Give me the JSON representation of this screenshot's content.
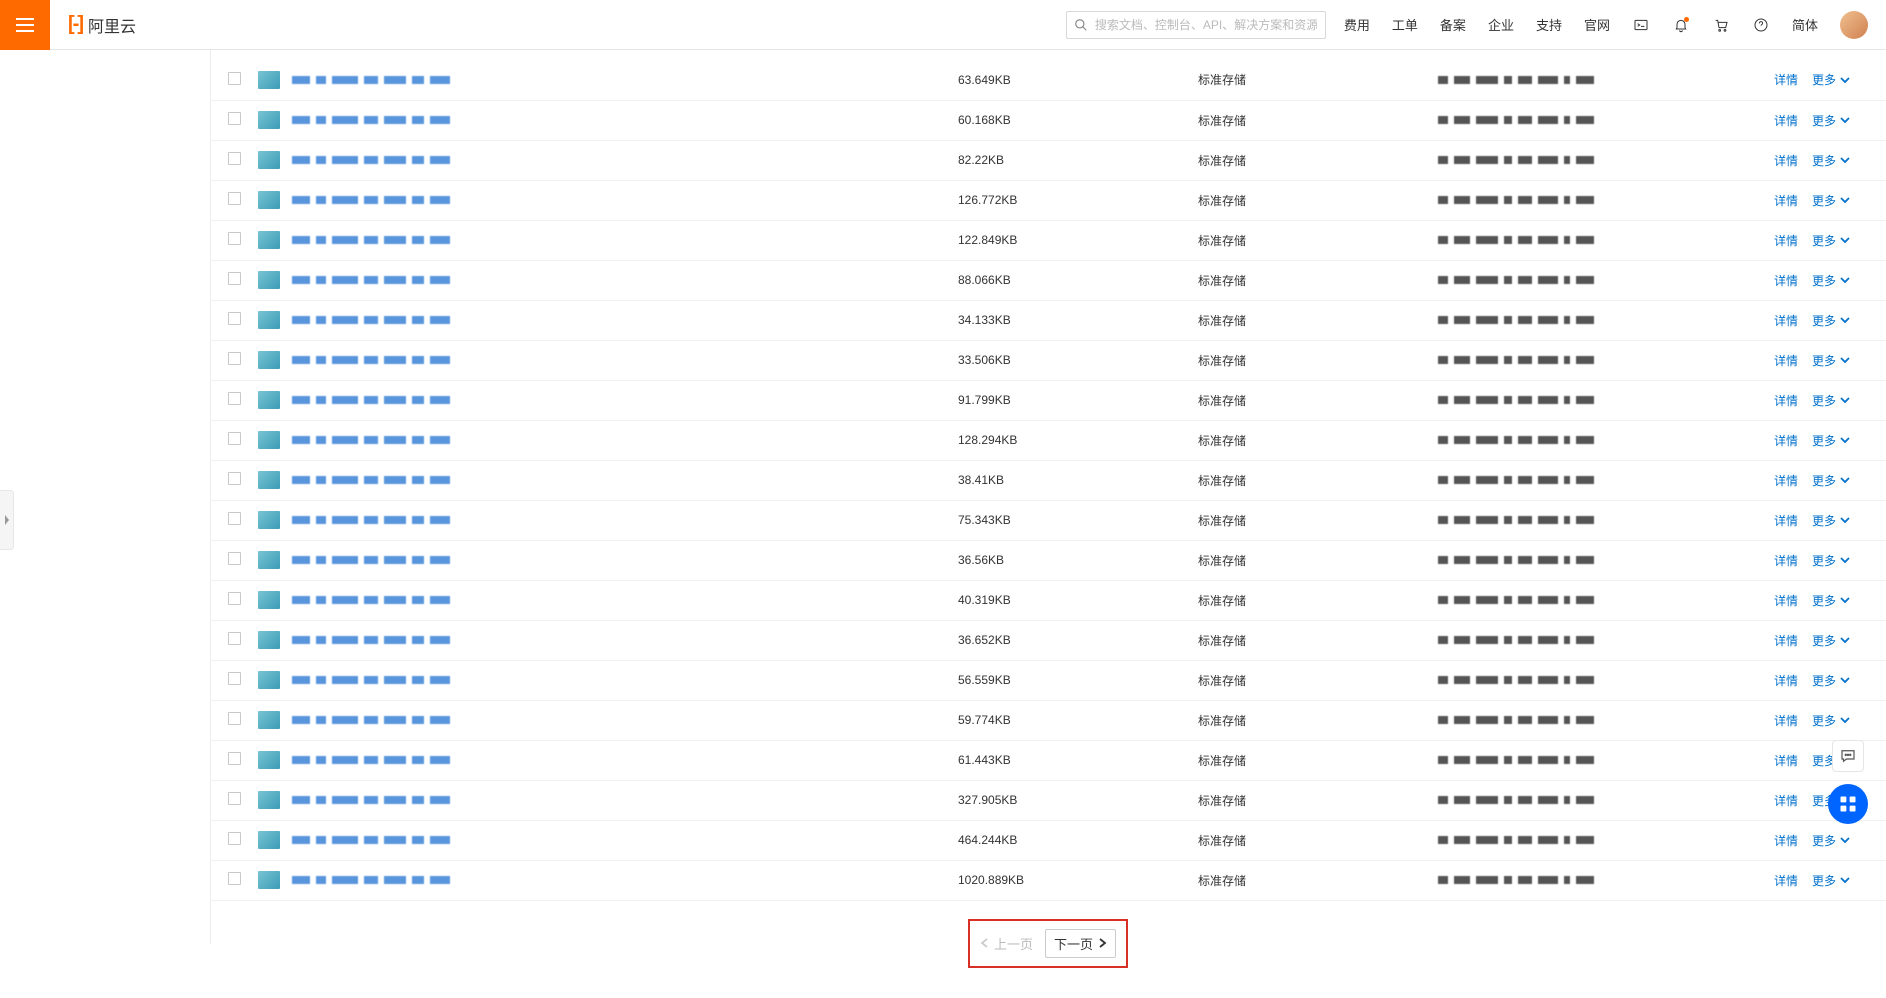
{
  "header": {
    "brand": "阿里云",
    "search_placeholder": "搜索文档、控制台、API、解决方案和资源",
    "nav": [
      "费用",
      "工单",
      "备案",
      "企业",
      "支持",
      "官网"
    ],
    "lang": "简体"
  },
  "table": {
    "storage_type_label": "标准存储",
    "action_detail": "详情",
    "action_more": "更多",
    "rows": [
      {
        "size": "63.649KB"
      },
      {
        "size": "60.168KB"
      },
      {
        "size": "82.22KB"
      },
      {
        "size": "126.772KB"
      },
      {
        "size": "122.849KB"
      },
      {
        "size": "88.066KB"
      },
      {
        "size": "34.133KB"
      },
      {
        "size": "33.506KB"
      },
      {
        "size": "91.799KB"
      },
      {
        "size": "128.294KB"
      },
      {
        "size": "38.41KB"
      },
      {
        "size": "75.343KB"
      },
      {
        "size": "36.56KB"
      },
      {
        "size": "40.319KB"
      },
      {
        "size": "36.652KB"
      },
      {
        "size": "56.559KB"
      },
      {
        "size": "59.774KB"
      },
      {
        "size": "61.443KB"
      },
      {
        "size": "327.905KB"
      },
      {
        "size": "464.244KB"
      },
      {
        "size": "1020.889KB"
      }
    ]
  },
  "pager": {
    "prev": "上一页",
    "next": "下一页"
  }
}
